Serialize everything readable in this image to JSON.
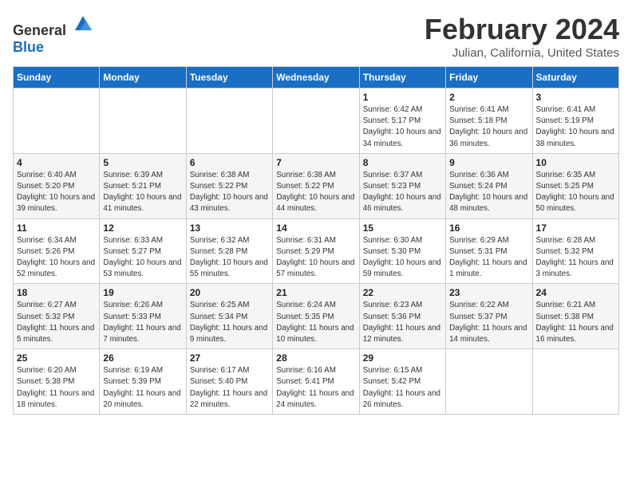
{
  "logo": {
    "general": "General",
    "blue": "Blue"
  },
  "header": {
    "month": "February 2024",
    "location": "Julian, California, United States"
  },
  "days_of_week": [
    "Sunday",
    "Monday",
    "Tuesday",
    "Wednesday",
    "Thursday",
    "Friday",
    "Saturday"
  ],
  "weeks": [
    [
      {
        "day": "",
        "sunrise": "",
        "sunset": "",
        "daylight": ""
      },
      {
        "day": "",
        "sunrise": "",
        "sunset": "",
        "daylight": ""
      },
      {
        "day": "",
        "sunrise": "",
        "sunset": "",
        "daylight": ""
      },
      {
        "day": "",
        "sunrise": "",
        "sunset": "",
        "daylight": ""
      },
      {
        "day": "1",
        "sunrise": "Sunrise: 6:42 AM",
        "sunset": "Sunset: 5:17 PM",
        "daylight": "Daylight: 10 hours and 34 minutes."
      },
      {
        "day": "2",
        "sunrise": "Sunrise: 6:41 AM",
        "sunset": "Sunset: 5:18 PM",
        "daylight": "Daylight: 10 hours and 36 minutes."
      },
      {
        "day": "3",
        "sunrise": "Sunrise: 6:41 AM",
        "sunset": "Sunset: 5:19 PM",
        "daylight": "Daylight: 10 hours and 38 minutes."
      }
    ],
    [
      {
        "day": "4",
        "sunrise": "Sunrise: 6:40 AM",
        "sunset": "Sunset: 5:20 PM",
        "daylight": "Daylight: 10 hours and 39 minutes."
      },
      {
        "day": "5",
        "sunrise": "Sunrise: 6:39 AM",
        "sunset": "Sunset: 5:21 PM",
        "daylight": "Daylight: 10 hours and 41 minutes."
      },
      {
        "day": "6",
        "sunrise": "Sunrise: 6:38 AM",
        "sunset": "Sunset: 5:22 PM",
        "daylight": "Daylight: 10 hours and 43 minutes."
      },
      {
        "day": "7",
        "sunrise": "Sunrise: 6:38 AM",
        "sunset": "Sunset: 5:22 PM",
        "daylight": "Daylight: 10 hours and 44 minutes."
      },
      {
        "day": "8",
        "sunrise": "Sunrise: 6:37 AM",
        "sunset": "Sunset: 5:23 PM",
        "daylight": "Daylight: 10 hours and 46 minutes."
      },
      {
        "day": "9",
        "sunrise": "Sunrise: 6:36 AM",
        "sunset": "Sunset: 5:24 PM",
        "daylight": "Daylight: 10 hours and 48 minutes."
      },
      {
        "day": "10",
        "sunrise": "Sunrise: 6:35 AM",
        "sunset": "Sunset: 5:25 PM",
        "daylight": "Daylight: 10 hours and 50 minutes."
      }
    ],
    [
      {
        "day": "11",
        "sunrise": "Sunrise: 6:34 AM",
        "sunset": "Sunset: 5:26 PM",
        "daylight": "Daylight: 10 hours and 52 minutes."
      },
      {
        "day": "12",
        "sunrise": "Sunrise: 6:33 AM",
        "sunset": "Sunset: 5:27 PM",
        "daylight": "Daylight: 10 hours and 53 minutes."
      },
      {
        "day": "13",
        "sunrise": "Sunrise: 6:32 AM",
        "sunset": "Sunset: 5:28 PM",
        "daylight": "Daylight: 10 hours and 55 minutes."
      },
      {
        "day": "14",
        "sunrise": "Sunrise: 6:31 AM",
        "sunset": "Sunset: 5:29 PM",
        "daylight": "Daylight: 10 hours and 57 minutes."
      },
      {
        "day": "15",
        "sunrise": "Sunrise: 6:30 AM",
        "sunset": "Sunset: 5:30 PM",
        "daylight": "Daylight: 10 hours and 59 minutes."
      },
      {
        "day": "16",
        "sunrise": "Sunrise: 6:29 AM",
        "sunset": "Sunset: 5:31 PM",
        "daylight": "Daylight: 11 hours and 1 minute."
      },
      {
        "day": "17",
        "sunrise": "Sunrise: 6:28 AM",
        "sunset": "Sunset: 5:32 PM",
        "daylight": "Daylight: 11 hours and 3 minutes."
      }
    ],
    [
      {
        "day": "18",
        "sunrise": "Sunrise: 6:27 AM",
        "sunset": "Sunset: 5:32 PM",
        "daylight": "Daylight: 11 hours and 5 minutes."
      },
      {
        "day": "19",
        "sunrise": "Sunrise: 6:26 AM",
        "sunset": "Sunset: 5:33 PM",
        "daylight": "Daylight: 11 hours and 7 minutes."
      },
      {
        "day": "20",
        "sunrise": "Sunrise: 6:25 AM",
        "sunset": "Sunset: 5:34 PM",
        "daylight": "Daylight: 11 hours and 9 minutes."
      },
      {
        "day": "21",
        "sunrise": "Sunrise: 6:24 AM",
        "sunset": "Sunset: 5:35 PM",
        "daylight": "Daylight: 11 hours and 10 minutes."
      },
      {
        "day": "22",
        "sunrise": "Sunrise: 6:23 AM",
        "sunset": "Sunset: 5:36 PM",
        "daylight": "Daylight: 11 hours and 12 minutes."
      },
      {
        "day": "23",
        "sunrise": "Sunrise: 6:22 AM",
        "sunset": "Sunset: 5:37 PM",
        "daylight": "Daylight: 11 hours and 14 minutes."
      },
      {
        "day": "24",
        "sunrise": "Sunrise: 6:21 AM",
        "sunset": "Sunset: 5:38 PM",
        "daylight": "Daylight: 11 hours and 16 minutes."
      }
    ],
    [
      {
        "day": "25",
        "sunrise": "Sunrise: 6:20 AM",
        "sunset": "Sunset: 5:38 PM",
        "daylight": "Daylight: 11 hours and 18 minutes."
      },
      {
        "day": "26",
        "sunrise": "Sunrise: 6:19 AM",
        "sunset": "Sunset: 5:39 PM",
        "daylight": "Daylight: 11 hours and 20 minutes."
      },
      {
        "day": "27",
        "sunrise": "Sunrise: 6:17 AM",
        "sunset": "Sunset: 5:40 PM",
        "daylight": "Daylight: 11 hours and 22 minutes."
      },
      {
        "day": "28",
        "sunrise": "Sunrise: 6:16 AM",
        "sunset": "Sunset: 5:41 PM",
        "daylight": "Daylight: 11 hours and 24 minutes."
      },
      {
        "day": "29",
        "sunrise": "Sunrise: 6:15 AM",
        "sunset": "Sunset: 5:42 PM",
        "daylight": "Daylight: 11 hours and 26 minutes."
      },
      {
        "day": "",
        "sunrise": "",
        "sunset": "",
        "daylight": ""
      },
      {
        "day": "",
        "sunrise": "",
        "sunset": "",
        "daylight": ""
      }
    ]
  ]
}
